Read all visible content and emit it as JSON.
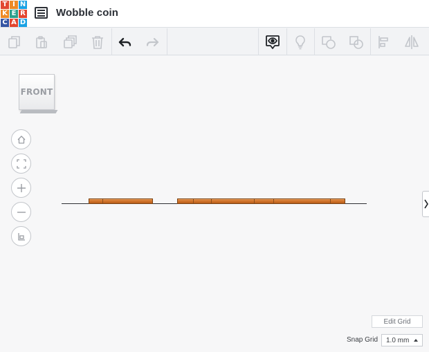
{
  "app": {
    "logo_letters": [
      "T",
      "I",
      "N",
      "K",
      "E",
      "R",
      "C",
      "A",
      "D"
    ],
    "document_title": "Wobble coin"
  },
  "toolbar": {
    "buttons": [
      {
        "name": "copy",
        "icon": "copy-icon",
        "enabled": false
      },
      {
        "name": "paste",
        "icon": "paste-icon",
        "enabled": false
      },
      {
        "name": "duplicate",
        "icon": "duplicate-icon",
        "enabled": false
      },
      {
        "name": "delete",
        "icon": "trash-icon",
        "enabled": false
      },
      {
        "name": "undo",
        "icon": "undo-icon",
        "enabled": true
      },
      {
        "name": "redo",
        "icon": "redo-icon",
        "enabled": false
      },
      {
        "name": "show-all",
        "icon": "eye-bubble-icon",
        "enabled": true
      },
      {
        "name": "lightbulb",
        "icon": "lightbulb-icon",
        "enabled": false
      },
      {
        "name": "group",
        "icon": "group-icon",
        "enabled": false
      },
      {
        "name": "ungroup",
        "icon": "ungroup-icon",
        "enabled": false
      },
      {
        "name": "align",
        "icon": "align-icon",
        "enabled": false
      },
      {
        "name": "mirror",
        "icon": "mirror-icon",
        "enabled": false
      }
    ]
  },
  "viewport": {
    "view_cube_label": "FRONT",
    "nav_buttons": [
      "home-icon",
      "fit-view-icon",
      "zoom-in-icon",
      "zoom-out-icon",
      "perspective-icon"
    ],
    "edit_grid_label": "Edit Grid",
    "snap_grid_label": "Snap Grid",
    "snap_grid_value": "1.0 mm"
  },
  "colors": {
    "shape_orange": "#c86a22",
    "ground_line": "#2d2f33",
    "toolbar_bg": "#f2f3f5"
  }
}
